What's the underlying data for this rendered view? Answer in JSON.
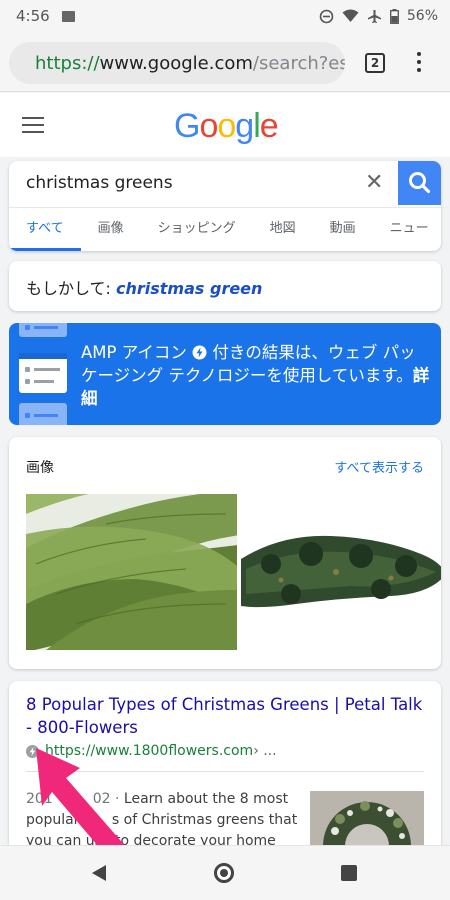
{
  "status_bar": {
    "time": "4:56",
    "battery": "56%"
  },
  "browser": {
    "url_scheme": "https://",
    "url_host": "www.google.com",
    "url_path": "/search?esr",
    "tab_count": "2"
  },
  "header": {
    "logo_letters": [
      "G",
      "o",
      "o",
      "g",
      "l",
      "e"
    ],
    "logo_colors": [
      "#4285f4",
      "#ea4335",
      "#fbbc05",
      "#4285f4",
      "#34a853",
      "#ea4335"
    ]
  },
  "search": {
    "query": "christmas greens",
    "tabs": [
      "すべて",
      "画像",
      "ショッピング",
      "地図",
      "動画",
      "ニュー"
    ]
  },
  "did_you_mean": {
    "prefix": "もしかして: ",
    "suggestion": "christmas green"
  },
  "amp_banner": {
    "text_before": "AMP アイコン",
    "text_after": "付きの結果は、ウェブ パッケージング テクノロジーを使用しています。",
    "link": "詳細"
  },
  "images_section": {
    "title": "画像",
    "see_all": "すべて表示する"
  },
  "result": {
    "title": "8 Popular Types of Christmas Greens | Petal Talk - 800-Flowers",
    "url_main": "https://www.1800flowers.com",
    "url_rest": " › ...",
    "date": "201",
    "date_tail": "02 · ",
    "snippet_1": "Learn about the 8 most",
    "snippet_2": "popular ",
    "snippet_2b": "s of Christmas greens that",
    "snippet_3": "you can use to decorate your home"
  },
  "colors": {
    "accent_blue": "#1a73e8",
    "link_blue": "#1a0dab",
    "url_green": "#188038",
    "annotation_pink": "#f0287a"
  }
}
